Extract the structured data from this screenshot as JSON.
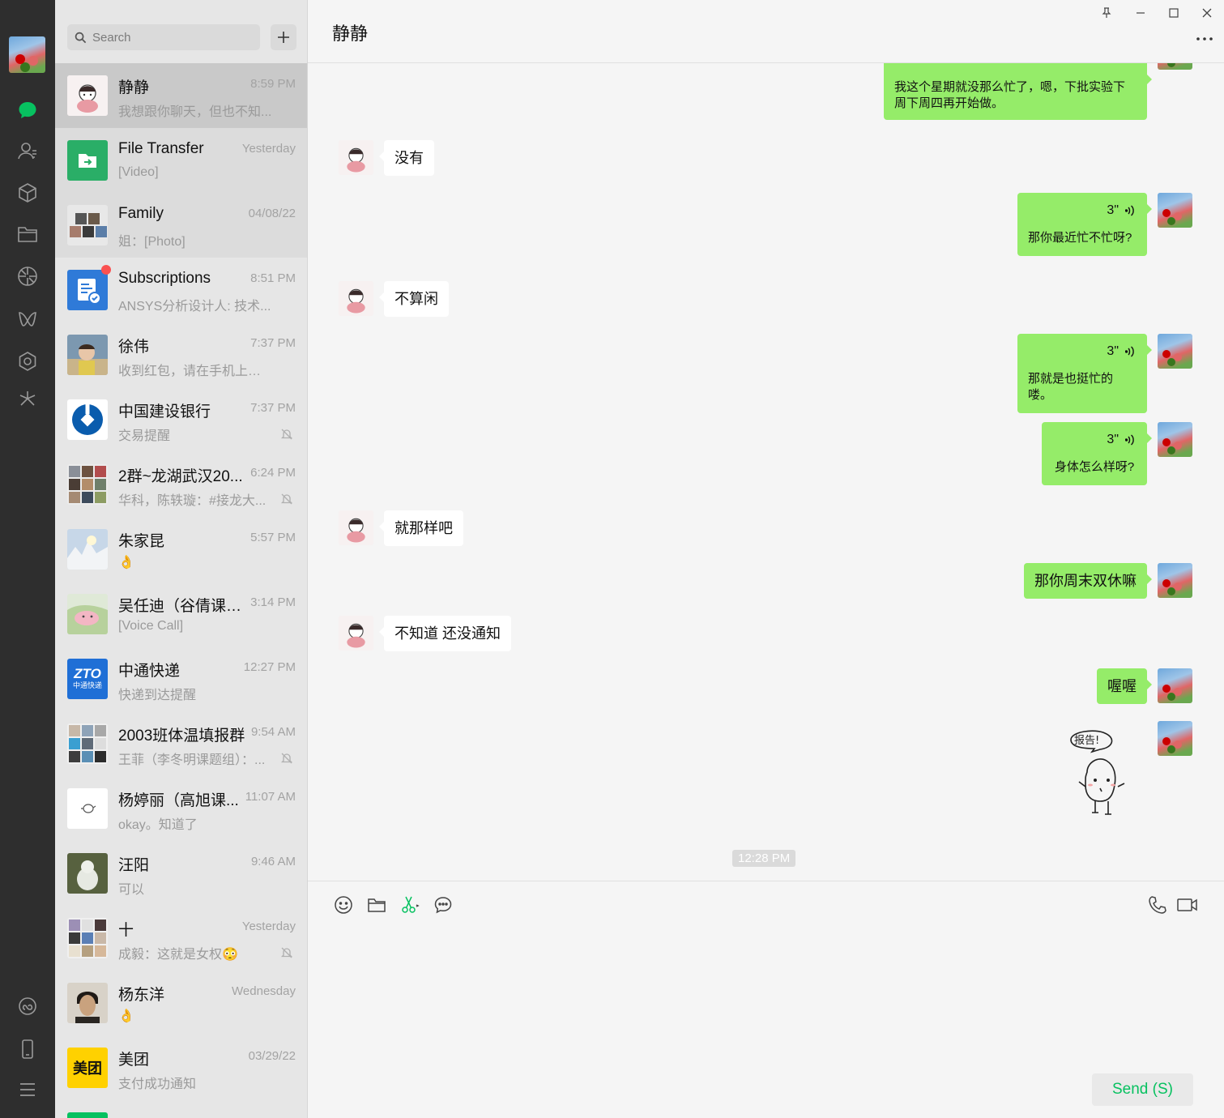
{
  "search": {
    "placeholder": "Search"
  },
  "list": [
    {
      "name": "静静",
      "time": "8:59 PM",
      "preview": "我想跟你聊天，但也不知...",
      "state": "active"
    },
    {
      "name": "File Transfer",
      "time": "Yesterday",
      "preview": "[Video]",
      "state": "pinned"
    },
    {
      "name": "Family",
      "time": "04/08/22",
      "preview": "姐：[Photo]",
      "state": "pinned"
    },
    {
      "name": "Subscriptions",
      "time": "8:51 PM",
      "preview": "ANSYS分析设计人: 技术...",
      "state": ""
    },
    {
      "name": "徐伟",
      "time": "7:37 PM",
      "preview": "收到红包，请在手机上查看",
      "state": ""
    },
    {
      "name": "中国建设银行",
      "time": "7:37 PM",
      "preview": "交易提醒",
      "state": ""
    },
    {
      "name": "2群~龙湖武汉20...",
      "time": "6:24 PM",
      "preview": "华科，陈轶璇：#接龙大...",
      "state": ""
    },
    {
      "name": "朱家昆",
      "time": "5:57 PM",
      "preview": "👌",
      "state": ""
    },
    {
      "name": "吴任迪（谷倩课题...",
      "time": "3:14 PM",
      "preview": "[Voice Call]",
      "state": ""
    },
    {
      "name": "中通快递",
      "time": "12:27 PM",
      "preview": "快递到达提醒",
      "state": ""
    },
    {
      "name": "2003班体温填报群",
      "time": "9:54 AM",
      "preview": "王菲（李冬明课题组）：...",
      "state": ""
    },
    {
      "name": "杨婷丽（高旭课...",
      "time": "11:07 AM",
      "preview": "okay。知道了",
      "state": ""
    },
    {
      "name": "汪阳",
      "time": "9:46 AM",
      "preview": "可以",
      "state": ""
    },
    {
      "name": "十",
      "time": "Yesterday",
      "preview": "成毅：这就是女权😳",
      "state": ""
    },
    {
      "name": "杨东洋",
      "time": "Wednesday",
      "preview": "👌",
      "state": ""
    },
    {
      "name": "美团",
      "time": "03/29/22",
      "preview": "支付成功通知",
      "state": ""
    }
  ],
  "avatar_texts": {
    "meituan": "美团",
    "zto": "ZTO",
    "zto_sub": "中通快递"
  },
  "chat": {
    "title": "静静",
    "messages": [
      {
        "from": "me",
        "text": "我这个星期就没那么忙了，嗯，下批实验下周下周四再开始做。"
      },
      {
        "from": "peer",
        "text": "没有"
      },
      {
        "from": "me",
        "voice": "3\"",
        "text": "那你最近忙不忙呀?"
      },
      {
        "from": "peer",
        "text": "不算闲"
      },
      {
        "from": "me",
        "voice": "3\"",
        "text": "那就是也挺忙的喽。"
      },
      {
        "from": "me",
        "voice": "3\"",
        "text": "身体怎么样呀?"
      },
      {
        "from": "peer",
        "text": "就那样吧"
      },
      {
        "from": "me",
        "text": "那你周末双休嘛"
      },
      {
        "from": "peer",
        "text": "不知道 还没通知"
      },
      {
        "from": "me",
        "text": "喔喔"
      },
      {
        "from": "me",
        "sticker": "报告!"
      }
    ],
    "timestamp": "12:28 PM"
  },
  "composer": {
    "send_label": "Send (S)"
  },
  "colors": {
    "accent": "#07c160",
    "bubble_out": "#95ec69",
    "rail": "#2e2e2e"
  }
}
